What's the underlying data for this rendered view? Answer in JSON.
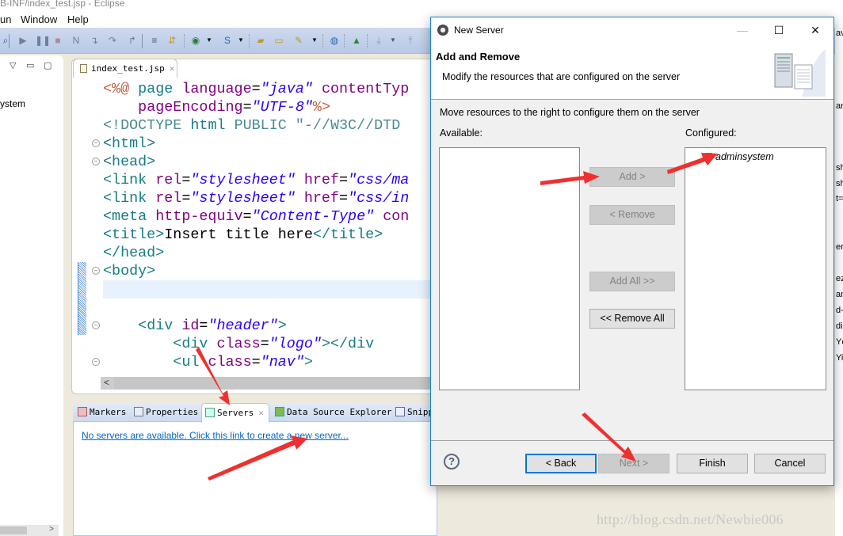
{
  "window": {
    "title": "B-INF/index_test.jsp - Eclipse",
    "menu": [
      "un",
      "Window",
      "Help"
    ]
  },
  "toolbar": {
    "icons": [
      "search-icon",
      "resume-icon",
      "suspend-icon",
      "terminate-icon",
      "disconnect-icon",
      "step-into-icon",
      "step-over-icon",
      "step-return-icon",
      "drop-to-frame-icon",
      "use-step-filters-icon",
      "new-server-icon",
      "new-snippet-icon",
      "open-project-icon",
      "open-folder-icon",
      "brush-icon",
      "web-browser-icon",
      "run-icon",
      "next-annotation-icon",
      "prev-annotation-icon"
    ]
  },
  "left_panel": {
    "tree_item_fragment": "ystem"
  },
  "editor": {
    "tab_label": "index_test.jsp",
    "lines": [
      [
        {
          "c": "c-dir",
          "t": "<%@ "
        },
        {
          "c": "c-tag",
          "t": "page "
        },
        {
          "c": "c-attr",
          "t": "language"
        },
        {
          "c": "c-txt",
          "t": "="
        },
        {
          "c": "c-str",
          "t": "\"java\""
        },
        {
          "c": "c-txt",
          "t": " "
        },
        {
          "c": "c-attr",
          "t": "contentTyp"
        }
      ],
      [
        {
          "c": "c-txt",
          "t": "    "
        },
        {
          "c": "c-attr",
          "t": "pageEncoding"
        },
        {
          "c": "c-txt",
          "t": "="
        },
        {
          "c": "c-str",
          "t": "\"UTF-8\""
        },
        {
          "c": "c-dir",
          "t": "%>"
        }
      ],
      [
        {
          "c": "c-doct",
          "t": "<!DOCTYPE "
        },
        {
          "c": "c-tag",
          "t": "html "
        },
        {
          "c": "c-doct",
          "t": "PUBLIC \"-//W3C//DTD"
        }
      ],
      [
        {
          "c": "c-tag",
          "t": "<html>"
        }
      ],
      [
        {
          "c": "c-tag",
          "t": "<head>"
        }
      ],
      [
        {
          "c": "c-tag",
          "t": "<link "
        },
        {
          "c": "c-attr",
          "t": "rel"
        },
        {
          "c": "c-txt",
          "t": "="
        },
        {
          "c": "c-str",
          "t": "\"stylesheet\""
        },
        {
          "c": "c-txt",
          "t": " "
        },
        {
          "c": "c-attr",
          "t": "href"
        },
        {
          "c": "c-txt",
          "t": "="
        },
        {
          "c": "c-str",
          "t": "\"css/ma"
        }
      ],
      [
        {
          "c": "c-tag",
          "t": "<link "
        },
        {
          "c": "c-attr",
          "t": "rel"
        },
        {
          "c": "c-txt",
          "t": "="
        },
        {
          "c": "c-str",
          "t": "\"stylesheet\""
        },
        {
          "c": "c-txt",
          "t": " "
        },
        {
          "c": "c-attr",
          "t": "href"
        },
        {
          "c": "c-txt",
          "t": "="
        },
        {
          "c": "c-str",
          "t": "\"css/in"
        }
      ],
      [
        {
          "c": "c-tag",
          "t": "<meta "
        },
        {
          "c": "c-attr",
          "t": "http-equiv"
        },
        {
          "c": "c-txt",
          "t": "="
        },
        {
          "c": "c-str",
          "t": "\"Content-Type\""
        },
        {
          "c": "c-txt",
          "t": " "
        },
        {
          "c": "c-attr",
          "t": "con"
        }
      ],
      [
        {
          "c": "c-tag",
          "t": "<title>"
        },
        {
          "c": "c-txt",
          "t": "Insert title here"
        },
        {
          "c": "c-tag",
          "t": "</title>"
        }
      ],
      [
        {
          "c": "c-tag",
          "t": "</head>"
        }
      ],
      [
        {
          "c": "c-tag",
          "t": "<body>"
        }
      ],
      [
        {
          "c": "c-txt",
          "t": ""
        }
      ],
      [
        {
          "c": "c-txt",
          "t": ""
        }
      ],
      [
        {
          "c": "c-txt",
          "t": "    "
        },
        {
          "c": "c-tag",
          "t": "<div "
        },
        {
          "c": "c-attr",
          "t": "id"
        },
        {
          "c": "c-txt",
          "t": "="
        },
        {
          "c": "c-str",
          "t": "\"header\""
        },
        {
          "c": "c-tag",
          "t": ">"
        }
      ],
      [
        {
          "c": "c-txt",
          "t": "        "
        },
        {
          "c": "c-tag",
          "t": "<div "
        },
        {
          "c": "c-attr",
          "t": "class"
        },
        {
          "c": "c-txt",
          "t": "="
        },
        {
          "c": "c-str",
          "t": "\"logo\""
        },
        {
          "c": "c-tag",
          "t": "></div"
        }
      ],
      [
        {
          "c": "c-txt",
          "t": "        "
        },
        {
          "c": "c-tag",
          "t": "<ul "
        },
        {
          "c": "c-attr",
          "t": "class"
        },
        {
          "c": "c-txt",
          "t": "="
        },
        {
          "c": "c-str",
          "t": "\"nav\""
        },
        {
          "c": "c-tag",
          "t": ">"
        }
      ]
    ]
  },
  "bottom_panel": {
    "tabs": [
      {
        "label": "Markers",
        "icon": "markers-icon"
      },
      {
        "label": "Properties",
        "icon": "properties-icon"
      },
      {
        "label": "Servers",
        "icon": "servers-icon",
        "active": true
      },
      {
        "label": "Data Source Explorer",
        "icon": "data-source-icon"
      },
      {
        "label": "Snipp",
        "icon": "snippets-icon"
      }
    ],
    "link_text": "No servers are available. Click this link to create a new server..."
  },
  "dialog": {
    "title": "New Server",
    "header_title": "Add and Remove",
    "header_desc": "Modify the resources that are configured on the server",
    "message": "Move resources to the right to configure them on the server",
    "available_label": "Available:",
    "configured_label": "Configured:",
    "available_items": [],
    "configured_items": [
      "adminsystem"
    ],
    "buttons": {
      "add": "Add >",
      "remove": "< Remove",
      "add_all": "Add All >>",
      "remove_all": "<< Remove All",
      "back": "< Back",
      "next": "Next >",
      "finish": "Finish",
      "cancel": "Cancel"
    },
    "help_glyph": "?"
  },
  "right_fragments": [
    "av",
    "an",
    "sh",
    "sh",
    "t=",
    "er",
    "ez",
    "an",
    "d-",
    "di",
    "Yc",
    "Yir"
  ],
  "watermark": "http://blog.csdn.net/Newbie006"
}
